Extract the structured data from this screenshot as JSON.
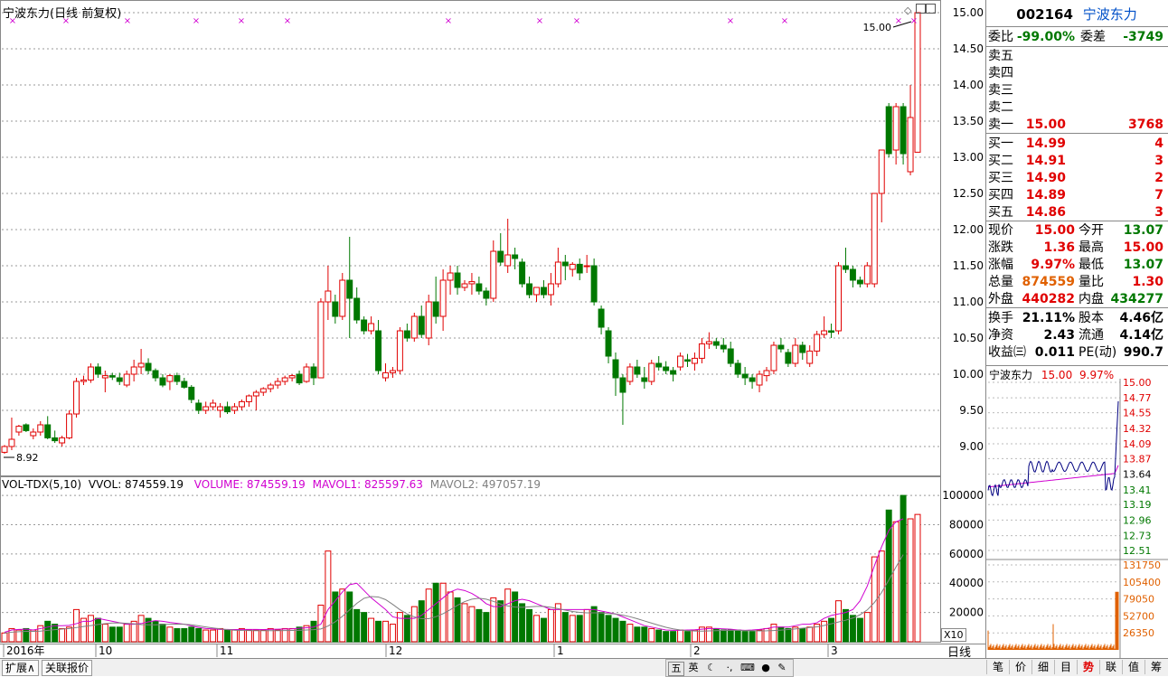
{
  "header": {
    "title": "宁波东力(日线 前复权)",
    "indicator_label": "VOL-TDX(5,10)",
    "vvol": "VVOL: 874559.19",
    "volume": "VOLUME: 874559.19",
    "mavol1": "MAVOL1: 825597.63",
    "mavol2": "MAVOL2: 497057.19",
    "low_marker": "8.92",
    "high_marker": "15.00",
    "x10": "X10",
    "period": "日线"
  },
  "colors": {
    "up": "#e00000",
    "down": "#007800",
    "mavol1": "#d000d0",
    "mavol2": "#808080",
    "grid": "#808080"
  },
  "price_axis": [
    "15.00",
    "14.50",
    "14.00",
    "13.50",
    "13.00",
    "12.50",
    "12.00",
    "11.50",
    "11.00",
    "10.50",
    "10.00",
    "9.50",
    "9.00"
  ],
  "volume_axis": [
    "100000",
    "80000",
    "60000",
    "40000",
    "20000"
  ],
  "date_labels": [
    "2016年",
    "10",
    "11",
    "12",
    "1",
    "2",
    "3"
  ],
  "chart_data": {
    "type": "candlestick",
    "ylim": [
      8.7,
      15.05
    ],
    "vol_ylim": [
      0,
      105000
    ],
    "candles": [
      [
        8.92,
        9.02,
        8.9,
        9.0,
        6000
      ],
      [
        9.0,
        9.4,
        8.95,
        9.1,
        9000
      ],
      [
        9.2,
        9.3,
        9.15,
        9.28,
        8000
      ],
      [
        9.3,
        9.32,
        9.2,
        9.22,
        9000
      ],
      [
        9.15,
        9.25,
        9.1,
        9.2,
        8000
      ],
      [
        9.2,
        9.35,
        9.15,
        9.3,
        11000
      ],
      [
        9.3,
        9.42,
        9.1,
        9.12,
        14000
      ],
      [
        9.12,
        9.22,
        9.05,
        9.08,
        12000
      ],
      [
        9.05,
        9.15,
        9.0,
        9.12,
        9000
      ],
      [
        9.12,
        9.5,
        9.1,
        9.45,
        10000
      ],
      [
        9.45,
        9.95,
        9.4,
        9.9,
        22000
      ],
      [
        9.9,
        9.98,
        9.85,
        9.92,
        16000
      ],
      [
        9.92,
        10.15,
        9.88,
        10.1,
        18000
      ],
      [
        10.1,
        10.15,
        9.95,
        10.0,
        16000
      ],
      [
        9.95,
        10.05,
        9.75,
        9.98,
        12000
      ],
      [
        9.98,
        10.02,
        9.92,
        9.96,
        10000
      ],
      [
        9.95,
        10.02,
        9.85,
        9.9,
        10000
      ],
      [
        9.85,
        10.05,
        9.82,
        10.0,
        12000
      ],
      [
        10.0,
        10.2,
        9.9,
        10.1,
        14000
      ],
      [
        10.1,
        10.35,
        10.0,
        10.15,
        18000
      ],
      [
        10.15,
        10.22,
        10.0,
        10.05,
        16000
      ],
      [
        10.05,
        10.08,
        9.9,
        9.95,
        14000
      ],
      [
        9.95,
        10.0,
        9.82,
        9.85,
        12000
      ],
      [
        9.9,
        10.0,
        9.78,
        9.98,
        10000
      ],
      [
        9.98,
        10.02,
        9.85,
        9.9,
        9000
      ],
      [
        9.9,
        9.95,
        9.8,
        9.82,
        9000
      ],
      [
        9.82,
        9.85,
        9.6,
        9.65,
        10000
      ],
      [
        9.6,
        9.65,
        9.45,
        9.5,
        9000
      ],
      [
        9.5,
        9.62,
        9.45,
        9.55,
        8000
      ],
      [
        9.55,
        9.65,
        9.5,
        9.6,
        8000
      ],
      [
        9.5,
        9.6,
        9.4,
        9.55,
        9000
      ],
      [
        9.55,
        9.62,
        9.45,
        9.48,
        8000
      ],
      [
        9.5,
        9.6,
        9.45,
        9.55,
        8000
      ],
      [
        9.55,
        9.65,
        9.5,
        9.62,
        9000
      ],
      [
        9.62,
        9.72,
        9.55,
        9.7,
        8000
      ],
      [
        9.7,
        9.78,
        9.5,
        9.75,
        8000
      ],
      [
        9.75,
        9.82,
        9.7,
        9.8,
        8000
      ],
      [
        9.8,
        9.88,
        9.75,
        9.85,
        9000
      ],
      [
        9.85,
        9.95,
        9.8,
        9.9,
        8000
      ],
      [
        9.9,
        9.98,
        9.85,
        9.95,
        9000
      ],
      [
        9.95,
        10.0,
        9.9,
        9.98,
        9000
      ],
      [
        10.0,
        10.05,
        9.85,
        9.88,
        10000
      ],
      [
        9.9,
        10.15,
        9.88,
        10.1,
        11000
      ],
      [
        10.1,
        10.15,
        9.85,
        9.95,
        14000
      ],
      [
        9.95,
        11.05,
        9.95,
        11.0,
        25000
      ],
      [
        11.0,
        11.5,
        10.75,
        11.15,
        62000
      ],
      [
        11.0,
        11.1,
        10.7,
        10.8,
        34000
      ],
      [
        10.8,
        11.4,
        10.75,
        11.3,
        36000
      ],
      [
        11.3,
        11.9,
        10.5,
        11.05,
        34000
      ],
      [
        11.05,
        11.2,
        10.7,
        10.75,
        22000
      ],
      [
        10.75,
        10.8,
        10.55,
        10.6,
        20000
      ],
      [
        10.6,
        10.8,
        10.55,
        10.7,
        16000
      ],
      [
        10.6,
        10.75,
        10.0,
        10.05,
        14000
      ],
      [
        9.95,
        10.15,
        9.9,
        10.02,
        14000
      ],
      [
        10.02,
        10.1,
        9.95,
        10.05,
        12000
      ],
      [
        10.05,
        10.65,
        10.0,
        10.6,
        20000
      ],
      [
        10.6,
        10.7,
        10.45,
        10.5,
        18000
      ],
      [
        10.5,
        10.85,
        10.45,
        10.8,
        24000
      ],
      [
        10.8,
        10.95,
        10.5,
        10.55,
        28000
      ],
      [
        10.5,
        11.1,
        10.4,
        11.0,
        36000
      ],
      [
        11.0,
        11.35,
        10.7,
        10.8,
        40000
      ],
      [
        10.8,
        11.45,
        10.6,
        11.3,
        40000
      ],
      [
        11.3,
        11.5,
        11.1,
        11.4,
        34000
      ],
      [
        11.4,
        11.5,
        11.1,
        11.2,
        30000
      ],
      [
        11.2,
        11.3,
        11.15,
        11.25,
        26000
      ],
      [
        11.25,
        11.4,
        11.1,
        11.28,
        24000
      ],
      [
        11.25,
        11.35,
        11.1,
        11.15,
        22000
      ],
      [
        11.15,
        11.2,
        10.95,
        11.05,
        20000
      ],
      [
        11.05,
        11.85,
        11.0,
        11.7,
        30000
      ],
      [
        11.7,
        11.95,
        11.5,
        11.55,
        28000
      ],
      [
        11.5,
        12.15,
        11.4,
        11.65,
        36000
      ],
      [
        11.65,
        11.75,
        11.45,
        11.6,
        34000
      ],
      [
        11.55,
        11.6,
        11.2,
        11.25,
        26000
      ],
      [
        11.25,
        11.35,
        11.05,
        11.1,
        22000
      ],
      [
        11.1,
        11.2,
        11.0,
        11.2,
        18000
      ],
      [
        11.2,
        11.3,
        11.05,
        11.1,
        16000
      ],
      [
        11.1,
        11.4,
        10.95,
        11.25,
        22000
      ],
      [
        11.25,
        11.75,
        11.2,
        11.55,
        26000
      ],
      [
        11.55,
        11.65,
        11.3,
        11.5,
        20000
      ],
      [
        11.45,
        11.55,
        11.35,
        11.52,
        18000
      ],
      [
        11.52,
        11.6,
        11.3,
        11.4,
        18000
      ],
      [
        11.5,
        11.65,
        11.4,
        11.5,
        22000
      ],
      [
        11.5,
        11.6,
        10.95,
        11.0,
        24000
      ],
      [
        10.9,
        10.95,
        10.55,
        10.65,
        20000
      ],
      [
        10.6,
        10.65,
        10.15,
        10.25,
        18000
      ],
      [
        10.2,
        10.3,
        9.7,
        9.95,
        16000
      ],
      [
        9.95,
        10.0,
        9.3,
        9.75,
        14000
      ],
      [
        9.9,
        10.15,
        9.85,
        10.1,
        12000
      ],
      [
        10.1,
        10.2,
        9.95,
        10.0,
        10000
      ],
      [
        9.95,
        10.1,
        9.8,
        9.9,
        10000
      ],
      [
        9.9,
        10.2,
        9.85,
        10.15,
        9000
      ],
      [
        10.15,
        10.25,
        10.05,
        10.1,
        8000
      ],
      [
        10.1,
        10.18,
        10.0,
        10.05,
        7000
      ],
      [
        10.05,
        10.1,
        9.9,
        10.0,
        7000
      ],
      [
        10.1,
        10.3,
        10.05,
        10.25,
        8000
      ],
      [
        10.2,
        10.28,
        10.1,
        10.18,
        7000
      ],
      [
        10.15,
        10.3,
        10.05,
        10.22,
        8000
      ],
      [
        10.22,
        10.5,
        10.15,
        10.42,
        10000
      ],
      [
        10.42,
        10.58,
        10.35,
        10.45,
        10000
      ],
      [
        10.45,
        10.5,
        10.35,
        10.4,
        9000
      ],
      [
        10.4,
        10.5,
        10.3,
        10.35,
        8000
      ],
      [
        10.35,
        10.45,
        10.1,
        10.15,
        8000
      ],
      [
        10.15,
        10.2,
        9.95,
        10.0,
        8000
      ],
      [
        10.0,
        10.1,
        9.85,
        9.95,
        7000
      ],
      [
        9.95,
        10.0,
        9.8,
        9.9,
        7000
      ],
      [
        9.85,
        10.05,
        9.75,
        10.0,
        8000
      ],
      [
        9.98,
        10.1,
        9.9,
        10.05,
        9000
      ],
      [
        10.05,
        10.45,
        10.0,
        10.4,
        12000
      ],
      [
        10.4,
        10.5,
        10.3,
        10.35,
        10000
      ],
      [
        10.3,
        10.35,
        10.1,
        10.15,
        9000
      ],
      [
        10.15,
        10.5,
        10.1,
        10.4,
        10000
      ],
      [
        10.4,
        10.45,
        10.2,
        10.3,
        9000
      ],
      [
        10.15,
        10.4,
        10.1,
        10.32,
        10000
      ],
      [
        10.32,
        10.6,
        10.25,
        10.55,
        12000
      ],
      [
        10.55,
        10.8,
        10.5,
        10.6,
        14000
      ],
      [
        10.6,
        10.7,
        10.5,
        10.58,
        16000
      ],
      [
        10.6,
        11.55,
        10.55,
        11.5,
        28000
      ],
      [
        11.5,
        11.75,
        11.4,
        11.45,
        22000
      ],
      [
        11.45,
        11.5,
        11.2,
        11.3,
        18000
      ],
      [
        11.3,
        11.35,
        11.2,
        11.25,
        16000
      ],
      [
        11.25,
        11.55,
        11.2,
        11.5,
        20000
      ],
      [
        11.25,
        12.5,
        11.2,
        12.5,
        58000
      ],
      [
        12.5,
        12.95,
        12.1,
        13.1,
        62000
      ],
      [
        13.7,
        13.75,
        13.0,
        13.05,
        90000
      ],
      [
        13.1,
        13.75,
        12.9,
        13.7,
        82000
      ],
      [
        13.7,
        13.75,
        12.9,
        13.05,
        100000
      ],
      [
        12.8,
        14.0,
        12.75,
        13.55,
        84000
      ],
      [
        13.07,
        15.0,
        13.07,
        15.0,
        87000
      ]
    ],
    "mavol1": [
      6500,
      8000,
      8400,
      8600,
      8000,
      9000,
      10000,
      11000,
      11000,
      11200,
      12400,
      14000,
      14000,
      16000,
      15000,
      14000,
      13000,
      12000,
      12000,
      12400,
      13600,
      14400,
      14000,
      13200,
      12600,
      12000,
      10800,
      9800,
      9000,
      8800,
      8400,
      8400,
      8300,
      8400,
      8400,
      8400,
      8300,
      8500,
      8600,
      8700,
      8800,
      9200,
      9600,
      10000,
      12000,
      22000,
      28000,
      34000,
      39000,
      40000,
      35000,
      30000,
      26000,
      22000,
      17000,
      16000,
      16000,
      16000,
      18000,
      22000,
      26000,
      30000,
      34000,
      36000,
      35000,
      33000,
      30000,
      26000,
      24000,
      24000,
      26000,
      28000,
      29000,
      28000,
      26000,
      24000,
      22000,
      22000,
      22000,
      22000,
      22000,
      22000,
      22000,
      21000,
      20000,
      19000,
      17000,
      15000,
      13000,
      11000,
      10000,
      9000,
      8000,
      7800,
      7800,
      8000,
      8200,
      8600,
      9000,
      9000,
      8800,
      8600,
      8000,
      7800,
      8000,
      8400,
      9000,
      10000,
      10000,
      10000,
      11000,
      12000,
      12000,
      13000,
      16000,
      18000,
      19000,
      20000,
      22000,
      28000,
      38000,
      52000,
      65000,
      76000,
      82000,
      84000
    ]
  }
}
